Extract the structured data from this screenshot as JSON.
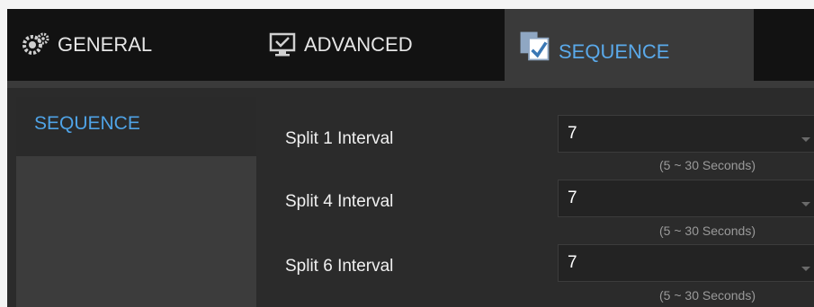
{
  "tabs": [
    {
      "label": "GENERAL",
      "icon": "gear-icon"
    },
    {
      "label": "ADVANCED",
      "icon": "monitor-icon"
    },
    {
      "label": "SEQUENCE",
      "icon": "sequence-icon",
      "active": true
    }
  ],
  "sidebar": {
    "items": [
      {
        "label": "SEQUENCE",
        "active": true
      }
    ]
  },
  "rows": [
    {
      "label": "Split 1 Interval",
      "value": "7",
      "hint": "(5 ~ 30 Seconds)"
    },
    {
      "label": "Split 4 Interval",
      "value": "7",
      "hint": "(5 ~ 30 Seconds)"
    },
    {
      "label": "Split 6 Interval",
      "value": "7",
      "hint": "(5 ~ 30 Seconds)"
    }
  ],
  "colors": {
    "accent": "#4fa3e6",
    "tabbar": "#121212",
    "active_tab": "#3a3a3a"
  }
}
